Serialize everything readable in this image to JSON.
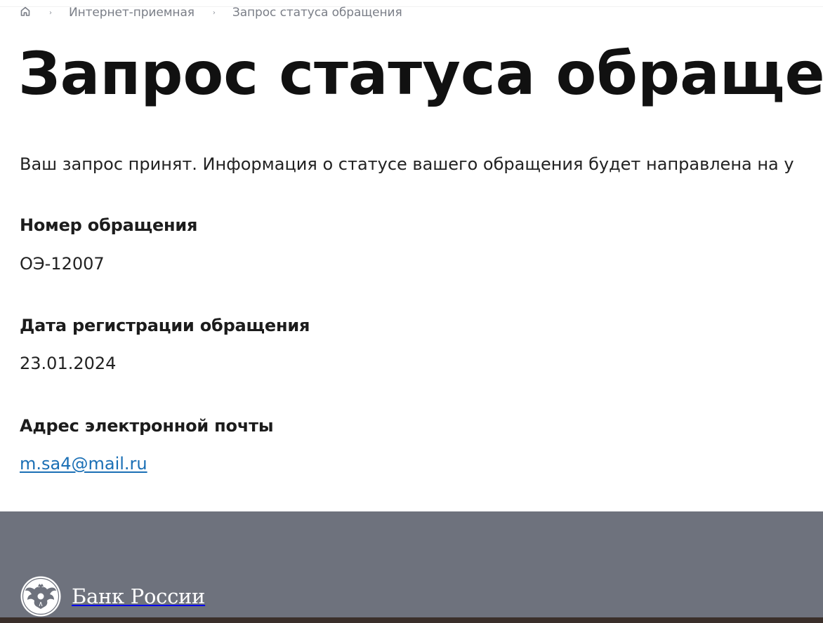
{
  "breadcrumb": {
    "home_icon": "home-icon",
    "items": [
      {
        "label": "Интернет-приемная"
      },
      {
        "label": "Запрос статуса обращения"
      }
    ]
  },
  "page": {
    "title": "Запрос статуса обращения",
    "intro": "Ваш запрос принят. Информация о статусе вашего обращения будет направлена на у"
  },
  "fields": [
    {
      "label": "Номер обращения",
      "value": "ОЭ-12007"
    },
    {
      "label": "Дата регистрации обращения",
      "value": "23.01.2024"
    },
    {
      "label": "Адрес электронной почты",
      "value": "m.sa4@mail.ru"
    }
  ],
  "footer": {
    "bank_name": "Банк России",
    "logo_icon": "double-headed-eagle-emblem-icon"
  },
  "colors": {
    "footer_bg": "#6e727d",
    "link": "#1a6fb5",
    "breadcrumb_text": "#7a7e87"
  }
}
